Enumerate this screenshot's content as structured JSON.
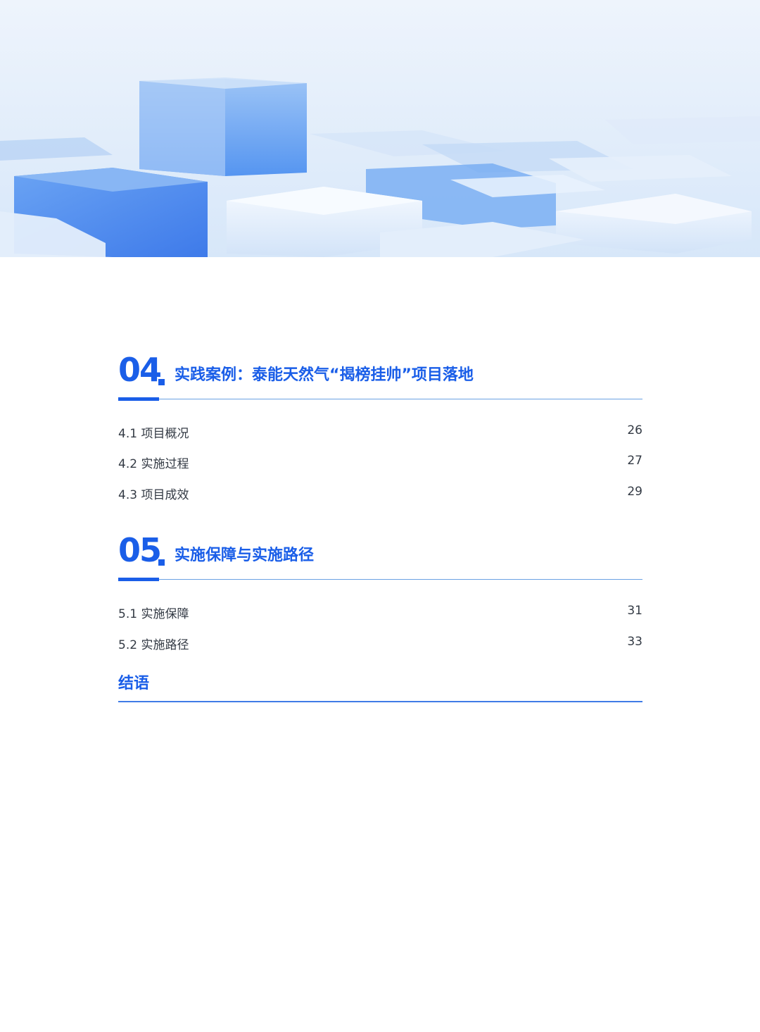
{
  "sections": [
    {
      "number": "04",
      "title": "实践案例：泰能天然气“揭榜挂帅”项目落地",
      "items": [
        {
          "label": "4.1 项目概况",
          "page": "26"
        },
        {
          "label": "4.2 实施过程",
          "page": "27"
        },
        {
          "label": "4.3 项目成效",
          "page": "29"
        }
      ]
    },
    {
      "number": "05",
      "title": "实施保障与实施路径",
      "items": [
        {
          "label": "5.1 实施保障",
          "page": "31"
        },
        {
          "label": "5.2 实施路径",
          "page": "33"
        }
      ]
    }
  ],
  "closing": {
    "title": "结语"
  },
  "colors": {
    "accent": "#1a5ee8",
    "rule": "#6aa2e3",
    "text": "#333a44"
  }
}
